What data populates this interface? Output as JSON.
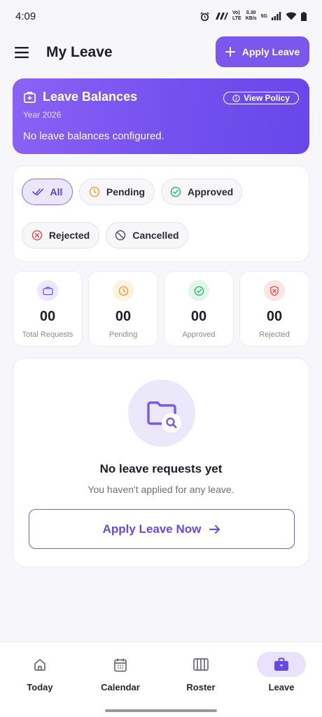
{
  "status_bar": {
    "time": "4:09",
    "network_top": "Vo)",
    "network_bottom": "LTE",
    "speed_top": "0.30",
    "speed_bottom": "KB/s",
    "signal": "5G"
  },
  "header": {
    "title": "My Leave",
    "apply_label": "Apply Leave"
  },
  "balances": {
    "title": "Leave Balances",
    "view_policy": "View Policy",
    "year": "Year 2026",
    "empty_text": "No leave balances configured."
  },
  "filters": [
    {
      "label": "All",
      "icon": "double-check-icon",
      "active": true
    },
    {
      "label": "Pending",
      "icon": "clock-icon",
      "active": false
    },
    {
      "label": "Approved",
      "icon": "check-circle-icon",
      "active": false
    },
    {
      "label": "Rejected",
      "icon": "x-circle-icon",
      "active": false
    },
    {
      "label": "Cancelled",
      "icon": "ban-icon",
      "active": false
    }
  ],
  "stats": [
    {
      "value": "00",
      "label": "Total Requests",
      "icon": "briefcase-icon",
      "color": "#7b57ee"
    },
    {
      "value": "00",
      "label": "Pending",
      "icon": "clock-icon",
      "color": "#e8a23a"
    },
    {
      "value": "00",
      "label": "Approved",
      "icon": "check-circle-icon",
      "color": "#2bb673"
    },
    {
      "value": "00",
      "label": "Rejected",
      "icon": "shield-x-icon",
      "color": "#e05252"
    }
  ],
  "empty_state": {
    "title": "No leave requests yet",
    "subtitle": "You haven't applied for any leave.",
    "button_label": "Apply Leave Now"
  },
  "nav": [
    {
      "label": "Today",
      "icon": "home-icon",
      "active": false
    },
    {
      "label": "Calendar",
      "icon": "calendar-icon",
      "active": false
    },
    {
      "label": "Roster",
      "icon": "roster-icon",
      "active": false
    },
    {
      "label": "Leave",
      "icon": "briefcase-icon",
      "active": true
    }
  ],
  "colors": {
    "accent": "#7b57ee",
    "background": "#f6f6fb"
  }
}
